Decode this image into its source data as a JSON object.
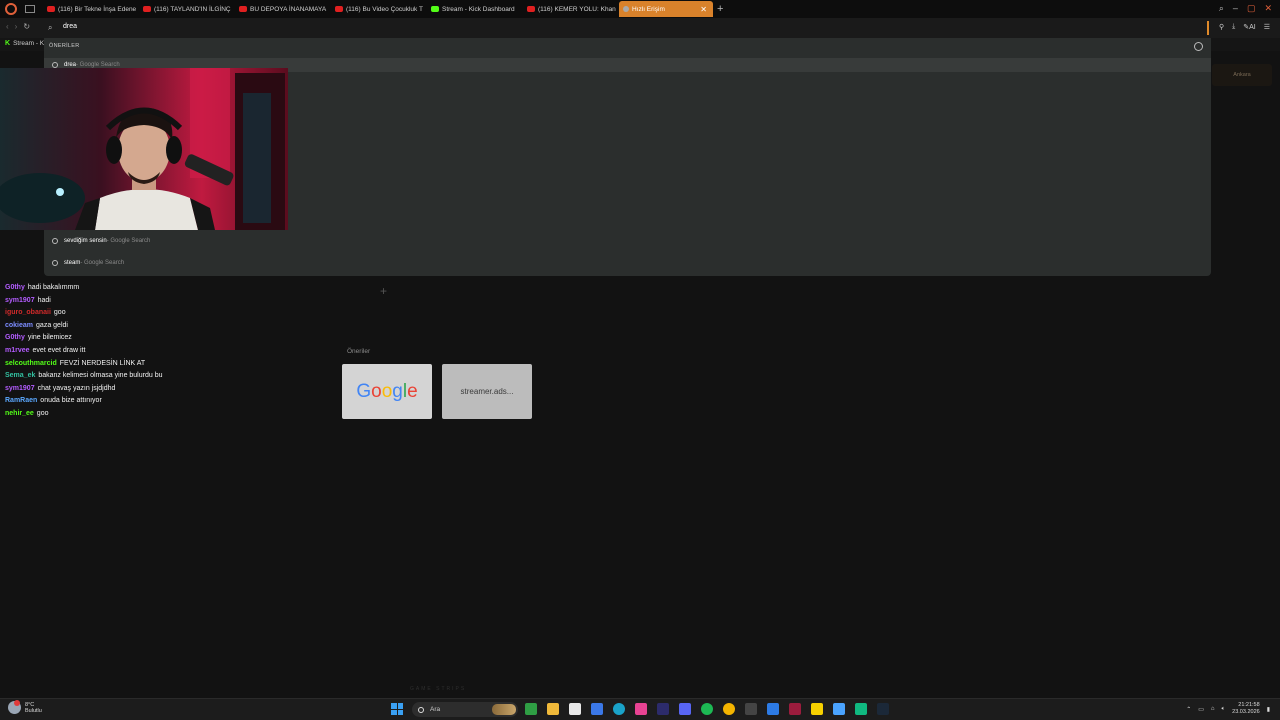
{
  "browser": {
    "tabs": [
      {
        "label": "(116) Bir Tekne İnşa Edene",
        "favicon": "youtube-icon"
      },
      {
        "label": "(116) TAYLAND'IN İLGİNÇ",
        "favicon": "youtube-icon"
      },
      {
        "label": "BU DEPOYA İNANAMAYA",
        "favicon": "youtube-icon"
      },
      {
        "label": "(116) Bu Video Çocukluk T",
        "favicon": "youtube-icon"
      },
      {
        "label": "Stream - Kick Dashboard",
        "favicon": "kick-icon"
      },
      {
        "label": "(116) KEMER YOLU: Khan",
        "favicon": "youtube-icon"
      },
      {
        "label": "Hızlı Erişim",
        "favicon": "star-icon",
        "active": true
      }
    ],
    "address_text": "drea",
    "ai_label": "AI",
    "bookmark": {
      "label": "Stream - K"
    }
  },
  "omnibox": {
    "header": "ÖNERİLER",
    "suggestions": [
      {
        "query": "drea",
        "suffix": " - Google Search",
        "selected": true
      },
      {
        "query": "sevdiğim sensin",
        "suffix": " - Google Search"
      },
      {
        "query": "steam",
        "suffix": " - Google Search"
      }
    ]
  },
  "ghost_button": "Ankara",
  "chat": [
    {
      "user": "G0thy",
      "msg": "hadi bakalımmm",
      "color": "#b35cff"
    },
    {
      "user": "sym1907",
      "msg": "hadi",
      "color": "#b35cff"
    },
    {
      "user": "iguro_obanaii",
      "msg": "goo",
      "color": "#d12a2a"
    },
    {
      "user": "cokieam",
      "msg": "gaza geldi",
      "color": "#7c8cff"
    },
    {
      "user": "G0thy",
      "msg": "yine bilemicez",
      "color": "#b35cff"
    },
    {
      "user": "m1rvee",
      "msg": "evet evet draw itt",
      "color": "#b35cff"
    },
    {
      "user": "selcouthmarcid",
      "msg": "FEVZİ NERDESİN LİNK AT",
      "color": "#53fc18"
    },
    {
      "user": "Sema_ek",
      "msg": "bakanz kelimesi olmasa yine bulurdu bu",
      "color": "#33c0a0"
    },
    {
      "user": "sym1907",
      "msg": "chat yavaş yazın jsjdjdhd",
      "color": "#b35cff"
    },
    {
      "user": "RamRaen",
      "msg": "onuda bize attınıyor",
      "color": "#5ba8ff"
    },
    {
      "user": "nehir_ee",
      "msg": "goo",
      "color": "#53fc18"
    }
  ],
  "speed_dial": {
    "title": "Öneriler",
    "tiles": [
      {
        "label": "Google",
        "type": "google"
      },
      {
        "label": "streamer.ads...",
        "type": "site"
      }
    ]
  },
  "footer_watermark": "GAME STRIPS",
  "taskbar": {
    "weather_temp": "8°C",
    "weather_desc": "Bulutlu",
    "search_placeholder": "Ara",
    "time": "21:21:58",
    "date": "23.03.2026"
  },
  "accent_color": "#d9822b"
}
